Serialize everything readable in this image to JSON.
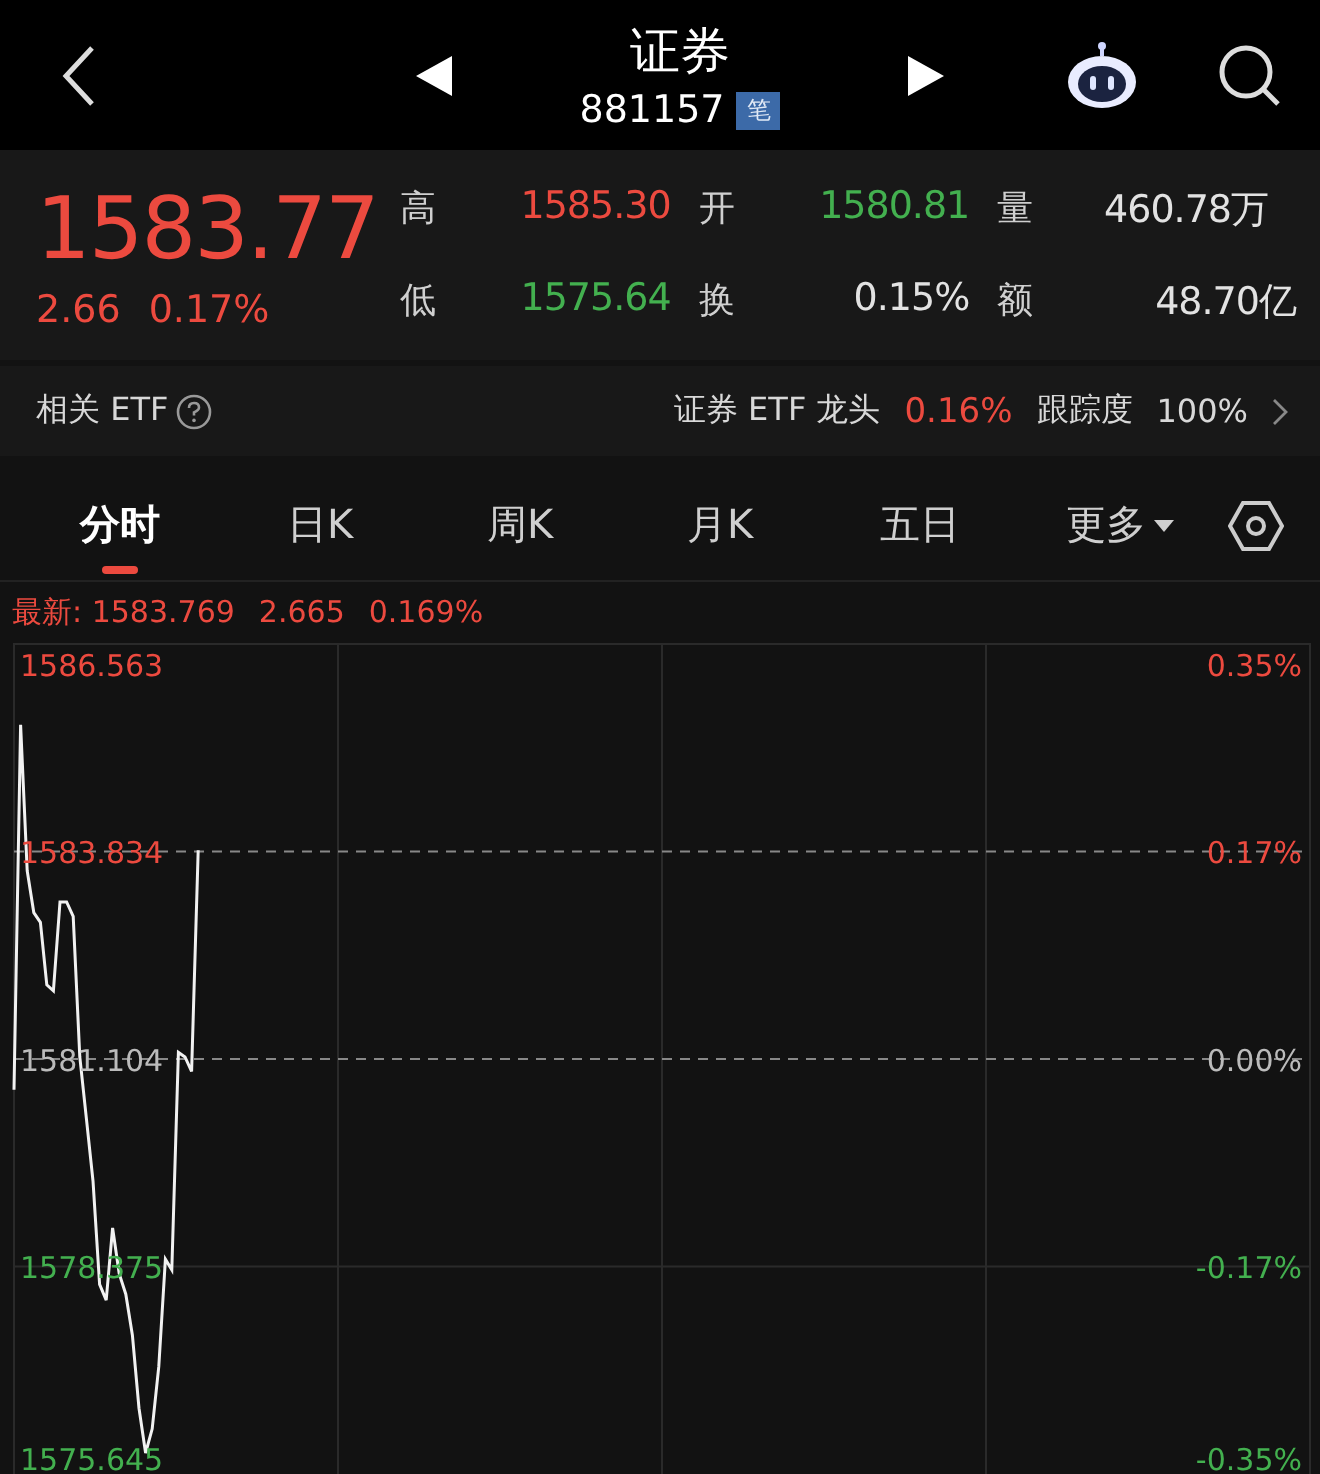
{
  "header": {
    "title": "证券",
    "code": "881157",
    "badge": "笔"
  },
  "quote": {
    "price": "1583.77",
    "change": "2.66",
    "change_pct": "0.17%",
    "stats": [
      {
        "label": "高",
        "value": "1585.30",
        "color": "#ec4a3f"
      },
      {
        "label": "开",
        "value": "1580.81",
        "color": "#43b04f"
      },
      {
        "label": "量",
        "value": "460.78万",
        "color": "#e2e2e2"
      },
      {
        "label": "低",
        "value": "1575.64",
        "color": "#43b04f"
      },
      {
        "label": "换",
        "value": "0.15%",
        "color": "#e2e2e2"
      },
      {
        "label": "额",
        "value": "48.70亿",
        "color": "#e2e2e2"
      }
    ]
  },
  "related_etf": {
    "label": "相关 ETF",
    "name": "证券 ETF 龙头",
    "change": "0.16%",
    "tracking_label": "跟踪度",
    "tracking": "100%"
  },
  "tabs": [
    {
      "label": "分时",
      "selected": true,
      "kind": "tab"
    },
    {
      "label": "日K",
      "selected": false,
      "kind": "tab"
    },
    {
      "label": "周K",
      "selected": false,
      "kind": "tab"
    },
    {
      "label": "月K",
      "selected": false,
      "kind": "tab"
    },
    {
      "label": "五日",
      "selected": false,
      "kind": "tab"
    },
    {
      "label": "更多",
      "selected": false,
      "kind": "dropdown"
    }
  ],
  "latest": {
    "label": "最新:",
    "price": "1583.769",
    "change": "2.665",
    "pct": "0.169%"
  },
  "chart": {
    "right_labels": [
      {
        "label": "0.35%",
        "color": "#ec4a3f"
      },
      {
        "label": "0.17%",
        "color": "#ec4a3f"
      },
      {
        "label": "0.00%",
        "color": "#bbbbbb"
      },
      {
        "label": "-0.17%",
        "color": "#43b04f"
      },
      {
        "label": "-0.35%",
        "color": "#43b04f"
      }
    ],
    "chart_data": {
      "type": "line",
      "grid": true,
      "ylim": [
        1575.645,
        1586.563
      ],
      "categories": [
        null,
        null,
        null,
        null,
        null,
        null,
        null,
        null,
        null,
        null,
        null,
        null,
        null,
        null,
        null,
        null,
        null,
        null,
        null,
        null,
        null,
        null,
        null,
        null,
        null,
        null,
        null,
        null,
        null,
        null,
        null,
        null,
        null,
        null,
        null,
        null,
        null,
        null,
        null,
        null,
        null,
        null,
        null,
        null,
        null,
        null,
        null,
        null,
        null,
        null,
        null,
        null,
        null,
        null,
        null,
        null,
        null,
        null,
        null,
        null,
        null,
        null,
        null,
        null,
        null,
        null,
        null,
        null,
        null,
        null,
        null,
        null,
        null,
        null,
        null,
        null,
        null,
        null,
        null,
        null,
        null,
        null,
        null,
        null,
        null,
        null,
        null,
        null,
        null,
        null,
        null,
        null,
        null,
        null,
        null,
        null,
        null,
        null,
        null,
        null,
        null,
        null,
        null,
        null,
        null,
        null,
        null,
        null,
        null,
        null,
        null,
        null,
        null,
        null,
        null,
        null,
        null,
        null,
        null,
        null,
        null,
        null,
        null,
        null,
        null,
        null,
        null,
        null,
        null,
        null,
        null,
        null,
        null,
        null,
        null,
        null,
        null,
        null,
        null,
        null,
        null,
        null,
        null,
        null,
        null,
        null,
        null,
        null,
        null,
        null,
        null,
        null,
        null,
        null,
        null,
        null,
        null,
        null,
        null,
        null,
        null,
        null,
        null,
        null,
        null,
        null,
        null,
        null,
        null,
        null,
        null,
        null,
        null,
        null,
        null,
        null,
        null,
        null,
        null,
        null,
        null,
        null,
        null,
        null,
        null,
        null,
        null,
        null,
        null,
        null,
        null,
        null,
        null,
        null,
        null,
        null,
        null,
        null
      ],
      "yticks": [
        {
          "value": 1586.563,
          "label": "1586.563"
        },
        {
          "value": 1583.834,
          "label": "1583.834"
        },
        {
          "value": 1581.104,
          "label": "1581.104"
        },
        {
          "value": 1578.375,
          "label": "1578.375"
        },
        {
          "value": 1575.645,
          "label": "1575.645"
        }
      ],
      "values": [
        1580.7,
        1585.5,
        1583.58,
        1583.03,
        1582.9,
        1582.08,
        1582.0,
        1583.17,
        1583.17,
        1582.98,
        1581.13,
        1580.32,
        1579.5,
        1578.14,
        1577.93,
        1578.88,
        1578.28,
        1578.01,
        1577.47,
        1576.51,
        1575.92,
        1576.24,
        1577.06,
        1578.47,
        1578.33,
        1581.19,
        1581.13,
        1580.94,
        1583.85,
        null,
        null,
        null,
        null,
        null,
        null,
        null,
        null,
        null,
        null,
        null,
        null,
        null,
        null,
        null,
        null,
        null,
        null,
        null,
        null,
        null,
        null,
        null,
        null,
        null,
        null,
        null,
        null,
        null,
        null,
        null,
        null,
        null,
        null,
        null,
        null,
        null,
        null,
        null,
        null,
        null,
        null,
        null,
        null,
        null,
        null,
        null,
        null,
        null,
        null,
        null,
        null,
        null,
        null,
        null,
        null,
        null,
        null,
        null,
        null,
        null,
        null,
        null,
        null,
        null,
        null,
        null,
        null,
        null,
        null,
        null,
        null,
        null,
        null,
        null,
        null,
        null,
        null,
        null,
        null,
        null,
        null,
        null,
        null,
        null,
        null,
        null,
        null,
        null,
        null,
        null,
        null,
        null,
        null,
        null,
        null,
        null,
        null,
        null,
        null,
        null,
        null,
        null,
        null,
        null,
        null,
        null,
        null,
        null,
        null,
        null,
        null,
        null,
        null,
        null,
        null,
        null,
        null,
        null,
        null,
        null,
        null,
        null,
        null,
        null,
        null,
        null,
        null,
        null,
        null,
        null,
        null,
        null,
        null,
        null,
        null,
        null,
        null,
        null,
        null,
        null,
        null,
        null,
        null,
        null,
        null,
        null,
        null,
        null,
        null,
        null,
        null,
        null,
        null,
        null,
        null,
        null,
        null,
        null,
        null,
        null,
        null,
        null,
        null,
        null,
        null,
        null,
        null,
        null
      ]
    }
  }
}
